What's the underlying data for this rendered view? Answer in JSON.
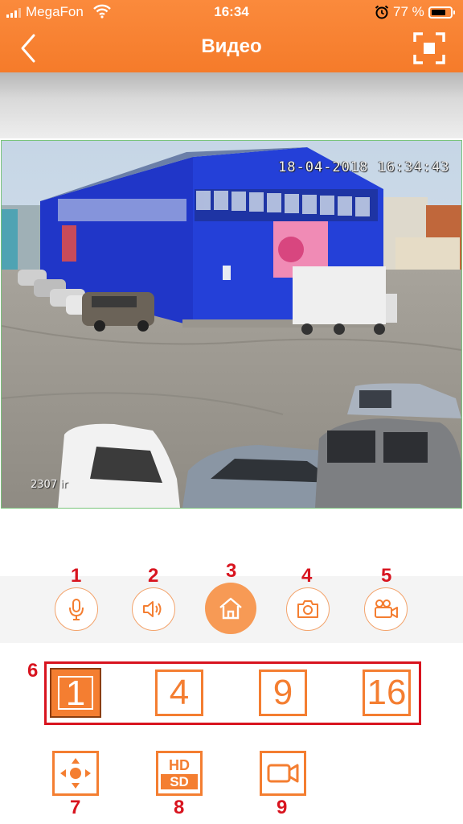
{
  "status_bar": {
    "carrier": "MegaFon",
    "time": "16:34",
    "battery": "77 %",
    "signal_icon": "signal-bars-icon",
    "wifi_icon": "wifi-icon",
    "alarm_icon": "alarm-clock-icon",
    "battery_icon": "battery-icon"
  },
  "nav": {
    "title": "Видео",
    "back_icon": "chevron-left-icon",
    "fullscreen_icon": "fullscreen-icon"
  },
  "video": {
    "timestamp": "18-04-2018 16:34:43",
    "camera_tag": "2307 ir"
  },
  "controls": [
    {
      "num": "1",
      "icon": "microphone-icon"
    },
    {
      "num": "2",
      "icon": "speaker-icon"
    },
    {
      "num": "3",
      "icon": "home-icon"
    },
    {
      "num": "4",
      "icon": "camera-icon"
    },
    {
      "num": "5",
      "icon": "video-camera-icon"
    }
  ],
  "layouts": {
    "num": "6",
    "options": [
      "1",
      "4",
      "9",
      "16"
    ],
    "selected": "1"
  },
  "tools": [
    {
      "num": "7",
      "icon": "ptz-direction-icon"
    },
    {
      "num": "8",
      "icon": "hd-sd-icon",
      "hd_label": "HD",
      "sd_label": "SD"
    },
    {
      "num": "9",
      "icon": "record-video-icon"
    }
  ],
  "colors": {
    "accent": "#f47e31",
    "annotation": "#d8141f",
    "header": "#f57b2a"
  }
}
